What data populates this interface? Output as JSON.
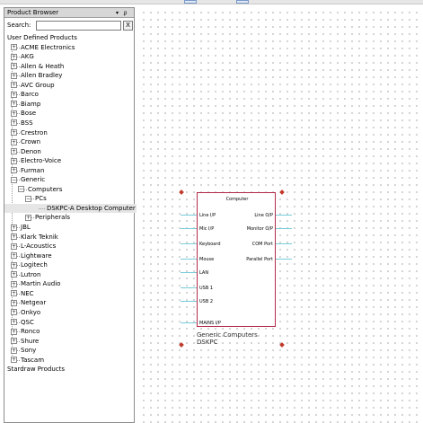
{
  "panel": {
    "title": "Product Browser",
    "dropdown_glyph": "▾",
    "pin_glyph": "ᵱ",
    "search_label": "Search:",
    "search_value": "",
    "clear_label": "X"
  },
  "tree": {
    "root_user": "User Defined Products",
    "manufacturers": [
      "ACME Electronics",
      "AKG",
      "Allen & Heath",
      "Allen Bradley",
      "AVC Group",
      "Barco",
      "Biamp",
      "Bose",
      "BSS",
      "Crestron",
      "Crown",
      "Denon",
      "Electro-Voice",
      "Furman",
      "Generic"
    ],
    "generic_children": {
      "computers": "Computers",
      "pcs": "PCs",
      "desktop": "DSKPC-A Desktop Computer",
      "peripherals": "Peripherals"
    },
    "manufacturers_after": [
      "JBL",
      "Klark Teknik",
      "L-Acoustics",
      "Lightware",
      "Logitech",
      "Lutron",
      "Martin Audio",
      "NEC",
      "Netgear",
      "Onkyo",
      "QSC",
      "Ronco",
      "Shure",
      "Sony",
      "Tascam"
    ],
    "root_stardraw": "Stardraw Products",
    "expand_plus": "+",
    "expand_minus": "−"
  },
  "device": {
    "title": "Computer",
    "inputs": [
      "Line I/P",
      "Mic I/P",
      "Keyboard",
      "Mouse",
      "LAN",
      "USB 1",
      "USB 2",
      "MAINS I/P"
    ],
    "outputs": [
      "Line O/P",
      "Monitor O/P",
      "COM Port",
      "Parallel Port"
    ],
    "caption_line1": "Generic Computers",
    "caption_line2": "DSKPC"
  },
  "colors": {
    "device_border": "#b22a4a",
    "port_stub": "#77ccd8",
    "handle": "#c0392b"
  }
}
